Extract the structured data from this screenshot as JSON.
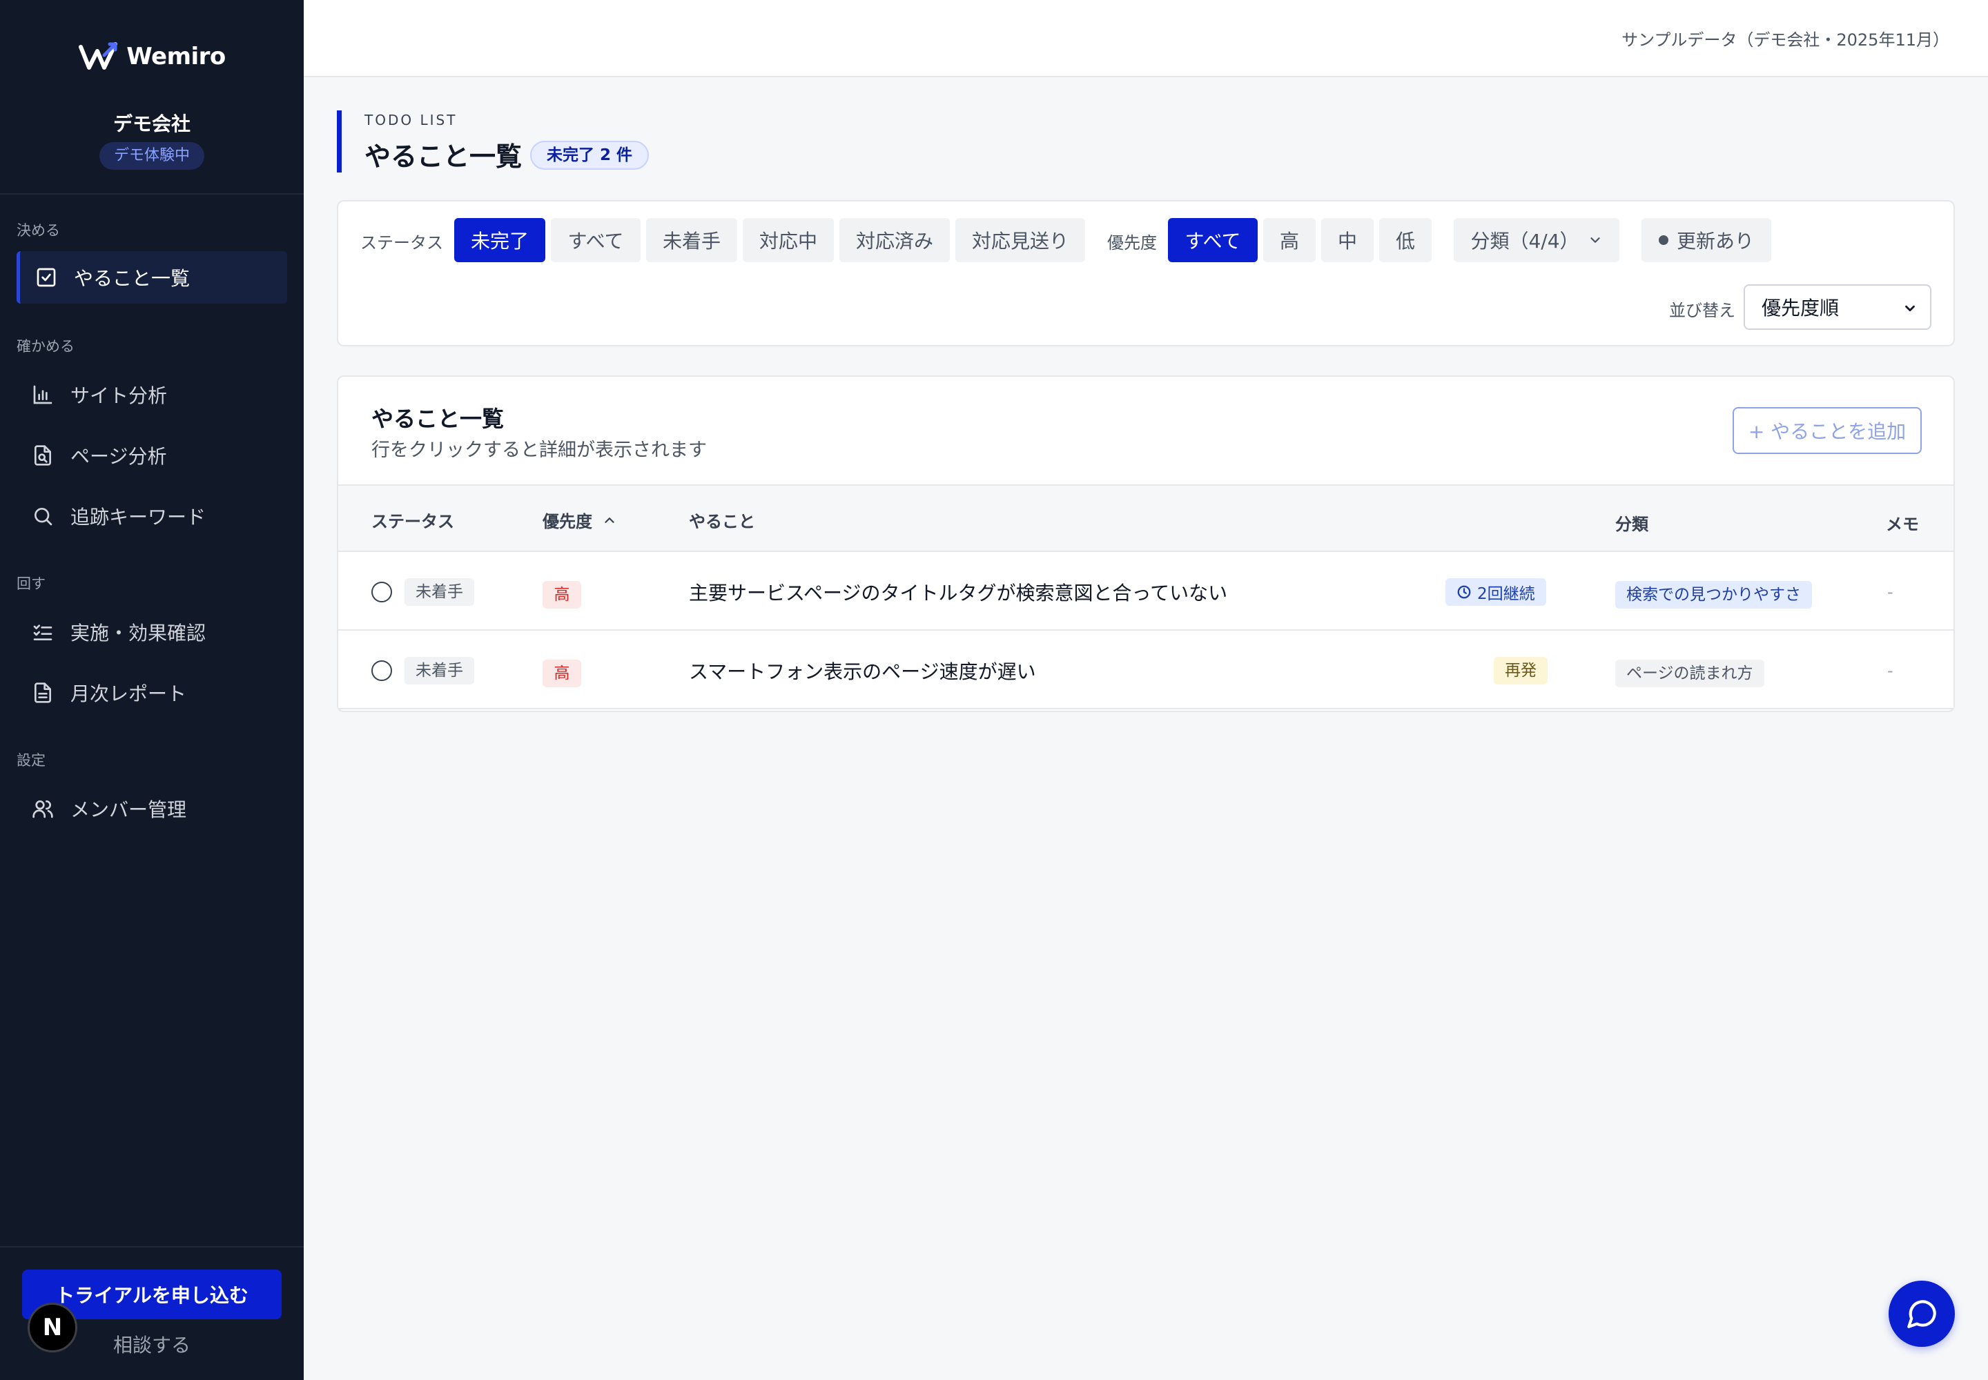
{
  "brand": {
    "name": "Wemiro",
    "color": "#0a1fd0"
  },
  "org": {
    "company": "デモ会社",
    "badge": "デモ体験中"
  },
  "topbar": {
    "note": "サンプルデータ（デモ会社・2025年11月）"
  },
  "sidebar": {
    "groups": [
      {
        "label": "決める",
        "items": [
          {
            "label": "やること一覧",
            "icon": "checkbox-icon",
            "active": true
          }
        ]
      },
      {
        "label": "確かめる",
        "items": [
          {
            "label": "サイト分析",
            "icon": "bar-chart-icon"
          },
          {
            "label": "ページ分析",
            "icon": "file-search-icon"
          },
          {
            "label": "追跡キーワード",
            "icon": "search-icon"
          }
        ]
      },
      {
        "label": "回す",
        "items": [
          {
            "label": "実施・効果確認",
            "icon": "list-checks-icon"
          },
          {
            "label": "月次レポート",
            "icon": "document-icon"
          }
        ]
      },
      {
        "label": "設定",
        "items": [
          {
            "label": "メンバー管理",
            "icon": "users-icon"
          }
        ]
      }
    ],
    "trial_button": "トライアルを申し込む",
    "consult_link": "相談する",
    "n_badge": "N"
  },
  "page": {
    "eyebrow": "TODO LIST",
    "title": "やること一覧",
    "count_badge": "未完了 2 件"
  },
  "filters": {
    "status_label": "ステータス",
    "status_options": [
      "未完了",
      "すべて",
      "未着手",
      "対応中",
      "対応済み",
      "対応見送り"
    ],
    "status_selected": "未完了",
    "priority_label": "優先度",
    "priority_options": [
      "すべて",
      "高",
      "中",
      "低"
    ],
    "priority_selected": "すべて",
    "category_dropdown": "分類（4/4）",
    "updated_toggle": "更新あり",
    "sort_label": "並び替え",
    "sort_value": "優先度順"
  },
  "table": {
    "title": "やること一覧",
    "subtitle": "行をクリックすると詳細が表示されます",
    "add_button": "+ やることを追加",
    "columns": {
      "status": "ステータス",
      "priority": "優先度",
      "task": "やること",
      "category": "分類",
      "memo": "メモ"
    },
    "rows": [
      {
        "status": "未着手",
        "priority": "高",
        "task": "主要サービスページのタイトルタグが検索意図と合っていない",
        "tag": "2回継続",
        "category": "検索での見つかりやすさ",
        "memo": "-"
      },
      {
        "status": "未着手",
        "priority": "高",
        "task": "スマートフォン表示のページ速度が遅い",
        "tag": "再発",
        "category": "ページの読まれ方",
        "memo": "-"
      }
    ]
  }
}
